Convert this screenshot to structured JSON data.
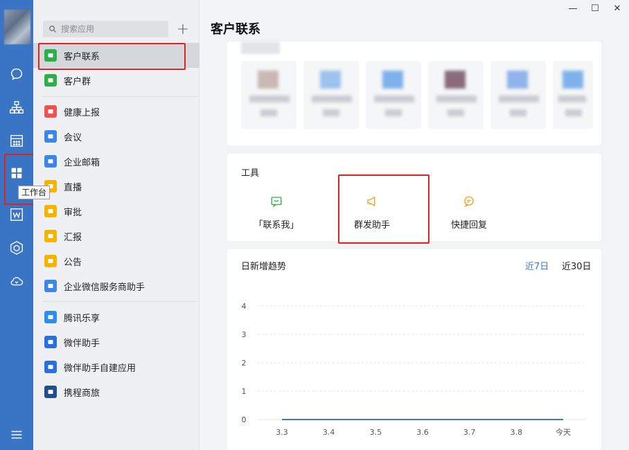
{
  "rail": {
    "tooltip": "工作台",
    "icons": [
      "chat-icon",
      "org-chart-icon",
      "calendar-icon",
      "workbench-grid-icon",
      "doc-w-icon",
      "cube-icon",
      "cloud-icon",
      "menu-icon"
    ]
  },
  "applist": {
    "search_placeholder": "搜索应用",
    "items": [
      {
        "label": "客户联系",
        "color": "#2db04a",
        "active": true
      },
      {
        "label": "客户群",
        "color": "#2db04a"
      },
      {
        "label": "健康上报",
        "color": "#ef5350"
      },
      {
        "label": "会议",
        "color": "#3b86e6"
      },
      {
        "label": "企业邮箱",
        "color": "#3b86e6"
      },
      {
        "label": "直播",
        "color": "#f4b400"
      },
      {
        "label": "审批",
        "color": "#f4b400"
      },
      {
        "label": "汇报",
        "color": "#f4b400"
      },
      {
        "label": "公告",
        "color": "#f4b400"
      },
      {
        "label": "企业微信服务商助手",
        "color": "#3b86e6"
      },
      {
        "label": "腾讯乐享",
        "color": "#2a8fe8"
      },
      {
        "label": "微伴助手",
        "color": "#2a6fe0"
      },
      {
        "label": "微伴助手自建应用",
        "color": "#2a6fe0"
      },
      {
        "label": "携程商旅",
        "color": "#1f4f8f"
      }
    ]
  },
  "main": {
    "title": "客户联系",
    "tools": {
      "title": "工具",
      "items": [
        {
          "label": "「联系我」",
          "icon": "contact-me-icon",
          "color": "#2db04a"
        },
        {
          "label": "群发助手",
          "icon": "megaphone-icon",
          "color": "#f0a020"
        },
        {
          "label": "快捷回复",
          "icon": "quick-reply-icon",
          "color": "#f0a020"
        }
      ]
    },
    "trend": {
      "title": "日新增趋势",
      "tab_7": "近7日",
      "tab_30": "近30日"
    }
  },
  "chart_data": {
    "type": "line",
    "categories": [
      "3.3",
      "3.4",
      "3.5",
      "3.6",
      "3.7",
      "3.8",
      "今天"
    ],
    "series": [
      {
        "values": [
          0,
          0,
          0,
          0,
          0,
          0,
          0
        ]
      }
    ],
    "y_ticks": [
      "0",
      "1",
      "2",
      "3",
      "4"
    ],
    "ylim": [
      0,
      4
    ],
    "grid": true,
    "line_color": "#3b74d6"
  }
}
